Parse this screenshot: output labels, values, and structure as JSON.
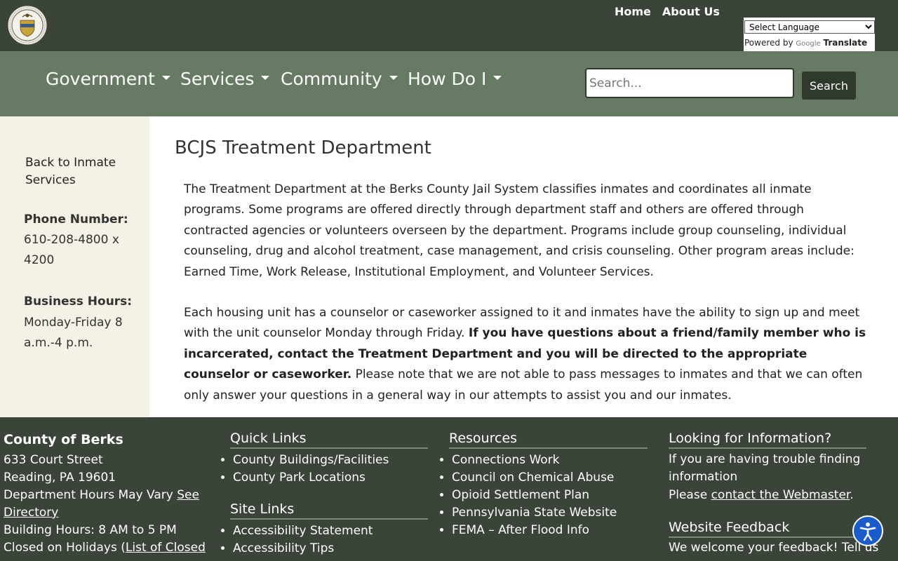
{
  "header": {
    "top_links": [
      "Home",
      "About Us"
    ],
    "language_select": "Select Language",
    "powered_by": "Powered by",
    "google": "Google",
    "translate": "Translate"
  },
  "nav": {
    "items": [
      "Government",
      "Services",
      "Community",
      "How Do I"
    ],
    "search_placeholder": "Search...",
    "search_button": "Search"
  },
  "sidebar": {
    "back_link": "Back to Inmate Services",
    "phone_label": "Phone Number:",
    "phone_value": "610-208-4800 x 4200",
    "hours_label": "Business Hours:",
    "hours_value": "Monday-Friday 8 a.m.-4 p.m."
  },
  "main": {
    "title": "BCJS Treatment Department",
    "para1": "The Treatment Department at the Berks County Jail System classifies inmates and coordinates all inmate programs. Some programs are offered directly through department staff and others are offered through contracted agencies or volunteers overseen by the department. Programs include group counseling, individual counseling, drug and alcohol treatment, case management, and crisis counseling. Other program areas include: Earned Time, Work Release, Institutional Employment, and Volunteer Services.",
    "para2_start": "Each housing unit has a counselor or caseworker assigned to it and inmates have the ability to sign up and meet with the unit counselor Monday through Friday.",
    "para2_bold": "If you have questions about a friend/family member who is incarcerated, contact the Treatment Department and you will be directed to the appropriate counselor or caseworker.",
    "para2_end": "Please note that we are not able to pass messages to inmates and that we can often only answer your questions in a general way in our attempts to assist you and our inmates."
  },
  "footer": {
    "county": {
      "name": "County of Berks",
      "street": "633 Court Street",
      "city": "Reading, PA 19601",
      "dept_hours": "Department Hours May Vary",
      "see_directory": "See Directory",
      "building_hours": "Building Hours: 8 AM to 5 PM",
      "holidays_prefix": "Closed on Holidays (",
      "holidays_link": "List of Closed"
    },
    "quick_links": {
      "heading": "Quick Links",
      "items": [
        "County Buildings/Facilities",
        "County Park Locations"
      ]
    },
    "site_links": {
      "heading": "Site Links",
      "items": [
        "Accessibility Statement",
        "Accessibility Tips"
      ]
    },
    "resources": {
      "heading": "Resources",
      "items": [
        "Connections Work",
        "Council on Chemical Abuse",
        "Opioid Settlement Plan",
        "Pennsylvania State Website",
        "FEMA – After Flood Info"
      ]
    },
    "looking": {
      "heading": "Looking for Information?",
      "text": "If you are having trouble finding information",
      "please": "Please",
      "link": "contact the Webmaster",
      "period": "."
    },
    "feedback": {
      "heading": "Website Feedback",
      "text": "We welcome your feedback! Tell us"
    }
  }
}
